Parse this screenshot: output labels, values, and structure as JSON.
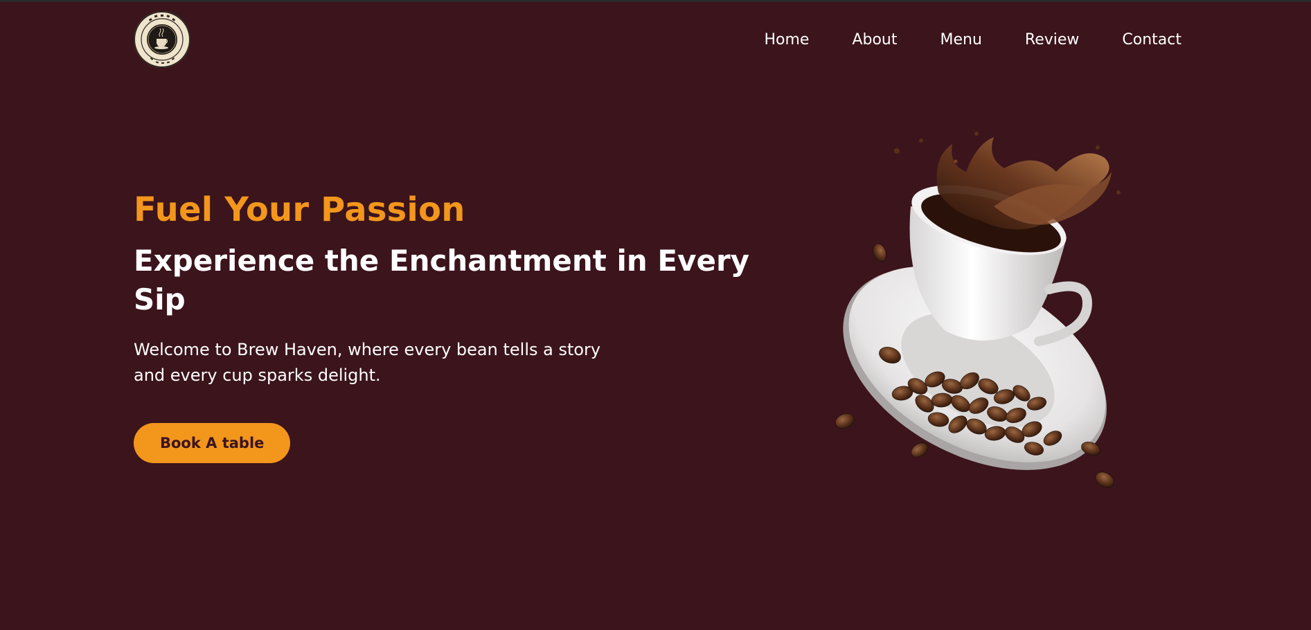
{
  "brand": {
    "logo_alt": "Brew Haven Cafe logo",
    "logo_ring_text": "BREW HAVEN CAFE",
    "logo_bottom_text": "YOUR CAFFEINE EXCHANGE"
  },
  "nav": {
    "items": [
      {
        "label": "Home"
      },
      {
        "label": "About"
      },
      {
        "label": "Menu"
      },
      {
        "label": "Review"
      },
      {
        "label": "Contact"
      }
    ]
  },
  "hero": {
    "title": "Fuel Your Passion",
    "subtitle": "Experience the Enchantment in Every Sip",
    "description": "Welcome to Brew Haven, where every bean tells a story and every cup sparks delight.",
    "button_label": "Book A table",
    "image_alt": "coffee cup with splash and beans"
  },
  "colors": {
    "background": "#3b141c",
    "accent": "#f3961c",
    "text": "#ffffff"
  }
}
